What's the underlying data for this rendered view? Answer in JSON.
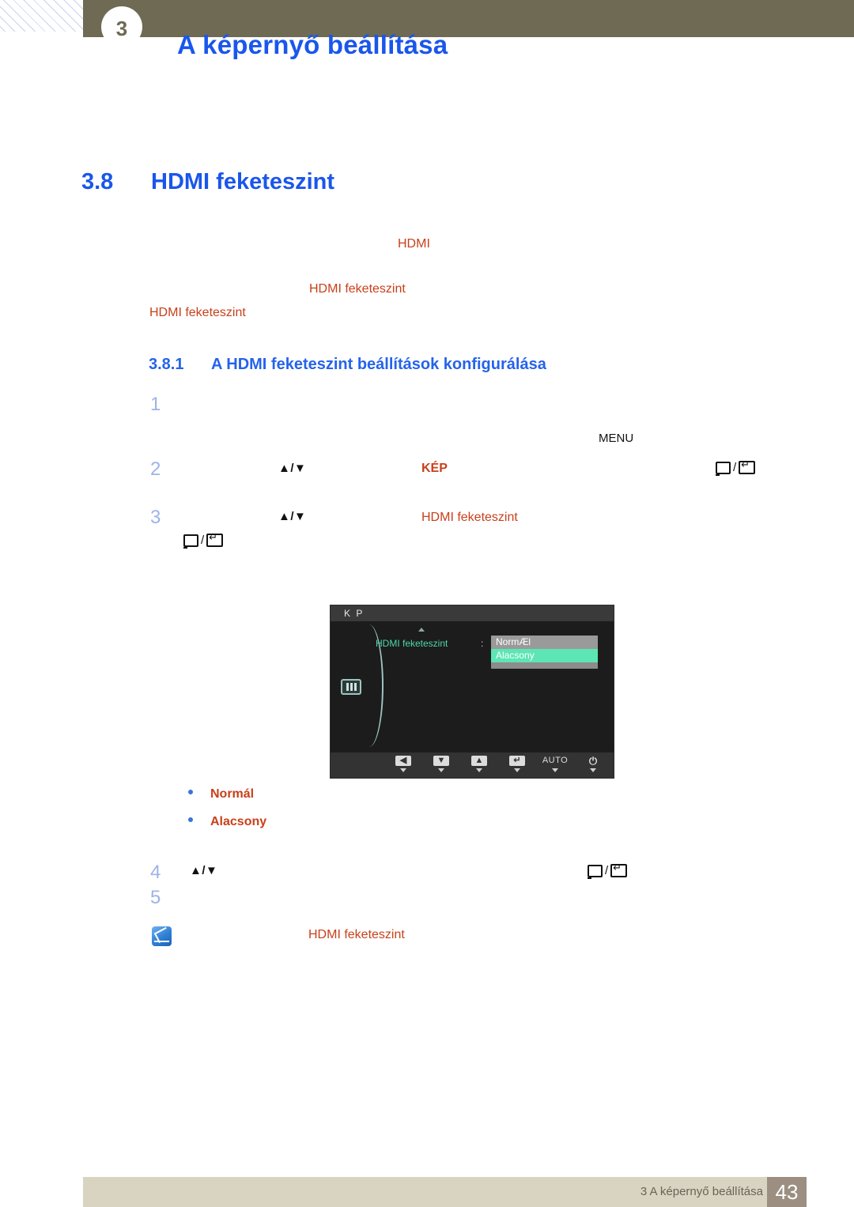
{
  "header": {
    "chapter_number": "3",
    "title": "A képernyő beállítása"
  },
  "section": {
    "number": "3.8",
    "title": "HDMI feketeszint"
  },
  "intro_fragments": {
    "line1": "HDMI",
    "line2": "HDMI feketeszint",
    "line3": "HDMI feketeszint"
  },
  "subsection": {
    "number": "3.8.1",
    "title": "A HDMI feketeszint beállítások konfigurálása"
  },
  "steps": {
    "n1": "1",
    "n2": "2",
    "n3": "3",
    "n4": "4",
    "n5": "5",
    "menu_label": "MENU",
    "arrows": "▲/▼",
    "kep_label": "KÉP",
    "hdmi_label": "HDMI feketeszint",
    "slash": "/"
  },
  "osd": {
    "title": "K P",
    "item_label": "HDMI feketeszint",
    "colon": ":",
    "options": [
      {
        "label": "NormÆl",
        "state": "normal"
      },
      {
        "label": "Alacsony",
        "state": "selected"
      }
    ],
    "buttons": [
      {
        "name": "back",
        "glyph": "◀"
      },
      {
        "name": "down",
        "glyph": "▼"
      },
      {
        "name": "up",
        "glyph": "▲"
      },
      {
        "name": "enter",
        "glyph": "↵"
      },
      {
        "name": "auto",
        "glyph": "AUTO"
      },
      {
        "name": "power",
        "glyph": "⏻"
      }
    ]
  },
  "bullets": [
    {
      "label": "Normál"
    },
    {
      "label": "Alacsony"
    }
  ],
  "note": {
    "text": "HDMI feketeszint"
  },
  "footer": {
    "text": "3 A képernyő beállítása",
    "page": "43"
  },
  "colors": {
    "header_band": "#6e6a53",
    "heading_blue": "#1a56ec",
    "accent_orange": "#c8401a",
    "step_number_blue": "#9db4e8",
    "osd_teal": "#4fd6ab",
    "osd_selected": "#5de6b4",
    "footer_bar": "#d9d3c2",
    "footer_page_box": "#9c8f82"
  }
}
